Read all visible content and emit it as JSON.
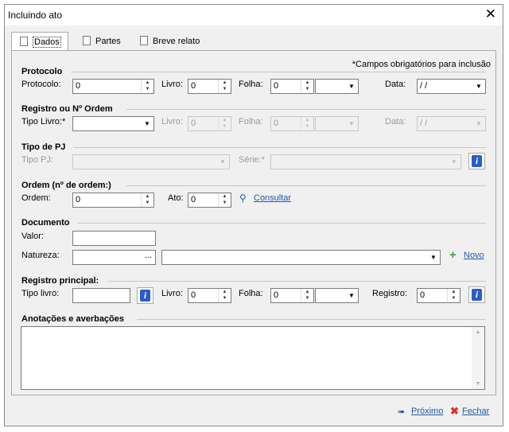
{
  "window": {
    "title": "Incluindo ato"
  },
  "tabs": [
    {
      "label": "Dados"
    },
    {
      "label": "Partes"
    },
    {
      "label": "Breve relato"
    }
  ],
  "required_note": "*Campos obrigatórios para inclusão",
  "protocolo": {
    "section": "Protocolo",
    "protocolo_label": "Protocolo:",
    "protocolo_value": "0",
    "livro_label": "Livro:",
    "livro_value": "0",
    "folha_label": "Folha:",
    "folha_value": "0",
    "data_label": "Data:",
    "data_value": " / /"
  },
  "registro": {
    "section": "Registro ou Nº Ordem",
    "tipo_livro_label": "Tipo Livro:*",
    "livro_label": "Livro:",
    "livro_value": "0",
    "folha_label": "Folha:",
    "folha_value": "0",
    "data_label": "Data:",
    "data_value": " / /"
  },
  "tipo_pj": {
    "section": "Tipo de PJ",
    "tipo_label": "Tipo PJ:",
    "serie_label": "Série:*"
  },
  "ordem": {
    "section": "Ordem (nº de ordem:)",
    "ordem_label": "Ordem:",
    "ordem_value": "0",
    "ato_label": "Ato:",
    "ato_value": "0",
    "consultar": "Consultar"
  },
  "documento": {
    "section": "Documento",
    "valor_label": "Valor:",
    "natureza_label": "Natureza:",
    "browse": "...",
    "novo": "Novo"
  },
  "principal": {
    "section": "Registro principal:",
    "tipo_label": "Tipo livro:",
    "livro_label": "Livro:",
    "livro_value": "0",
    "folha_label": "Folha:",
    "folha_value": "0",
    "registro_label": "Registro:",
    "registro_value": "0"
  },
  "anotacoes": {
    "section": "Anotações e averbações"
  },
  "footer": {
    "next": "Próximo",
    "close": "Fechar"
  },
  "colors": {
    "link": "#1e5aa8",
    "info": "#2a5cc8",
    "add": "#3aa53a",
    "close": "#d9342b"
  }
}
